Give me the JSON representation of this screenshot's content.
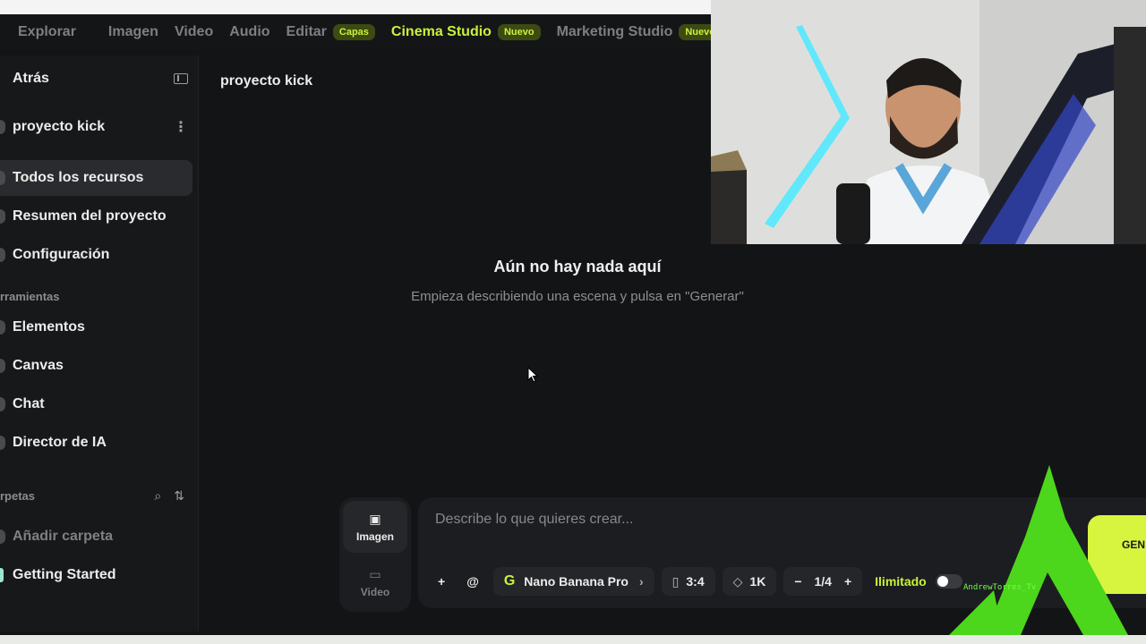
{
  "topnav": {
    "items": [
      {
        "label": "Explorar"
      },
      {
        "label": "Imagen"
      },
      {
        "label": "Video"
      },
      {
        "label": "Audio"
      },
      {
        "label": "Editar",
        "badge": "Capas"
      },
      {
        "label": "Cinema Studio",
        "badge": "Nuevo"
      },
      {
        "label": "Marketing Studio",
        "badge": "Nuevo"
      }
    ]
  },
  "sidebar": {
    "back_label": "Atrás",
    "project_name": "proyecto kick",
    "menu": [
      {
        "label": "Todos los recursos"
      },
      {
        "label": "Resumen del proyecto"
      },
      {
        "label": "Configuración"
      }
    ],
    "tools_label": "rramientas",
    "tools": [
      {
        "label": "Elementos"
      },
      {
        "label": "Canvas"
      },
      {
        "label": "Chat"
      },
      {
        "label": "Director de IA"
      }
    ],
    "folders_label": "rpetas",
    "add_folder": "Añadir carpeta",
    "folder_items": [
      {
        "label": "Getting Started"
      }
    ]
  },
  "main": {
    "breadcrumb": "proyecto kick",
    "empty_title": "Aún no hay nada aquí",
    "empty_subtitle": "Empieza describiendo una escena y pulsa en \"Generar\""
  },
  "composer": {
    "modes": [
      {
        "label": "Imagen"
      },
      {
        "label": "Video"
      }
    ],
    "placeholder": "Describe lo que quieres crear...",
    "model": "Nano Banana Pro",
    "aspect": "3:4",
    "resolution": "1K",
    "count": "1/4",
    "unlimited_label": "Ilimitado",
    "generate_label": "GEN"
  },
  "watermark": "AndrewTorres_Tv",
  "colors": {
    "accent": "#c9f23a",
    "background": "#131416",
    "panel": "#1c1d20"
  }
}
